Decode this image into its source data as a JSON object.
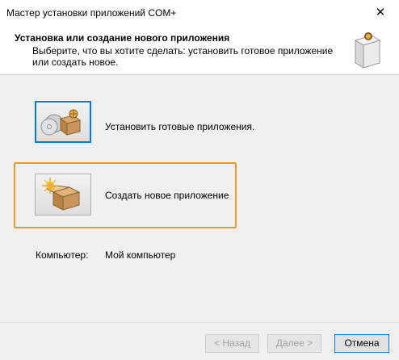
{
  "window": {
    "title": "Мастер установки приложений COM+",
    "close_glyph": "✕"
  },
  "header": {
    "title": "Установка или создание нового приложения",
    "subtitle": "Выберите, что вы хотите сделать: установить готовое приложение или создать новое.",
    "icon": "wizard-box-icon"
  },
  "options": [
    {
      "label": "Установить готовые приложения.",
      "icon": "cd-box-icon",
      "focused": true
    },
    {
      "label": "Создать новое приложение",
      "icon": "new-box-icon",
      "highlighted": true
    }
  ],
  "computer": {
    "label": "Компьютер:",
    "value": "Мой компьютер"
  },
  "buttons": {
    "back": "< Назад",
    "next": "Далее >",
    "cancel": "Отмена"
  },
  "colors": {
    "focus_border": "#0078d7",
    "highlight_border": "#f59a23",
    "content_bg": "#f0f0f0"
  }
}
